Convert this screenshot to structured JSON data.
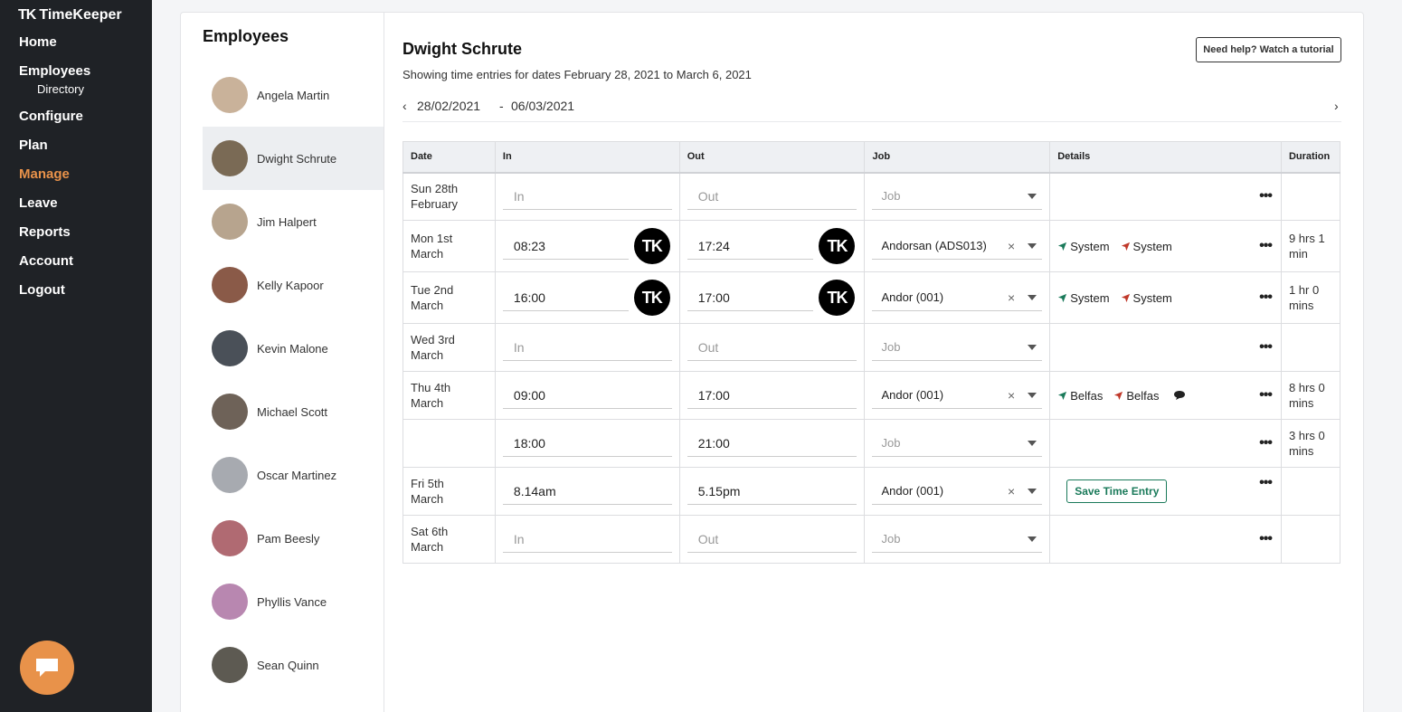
{
  "app": {
    "logo_mark": "TK",
    "logo_text": "TimeKeeper"
  },
  "nav": {
    "home": "Home",
    "employees": "Employees",
    "directory": "Directory",
    "configure": "Configure",
    "plan": "Plan",
    "manage": "Manage",
    "leave": "Leave",
    "reports": "Reports",
    "account": "Account",
    "logout": "Logout",
    "active": "Manage"
  },
  "colors": {
    "accent": "#e8924a",
    "sidebar": "#1f2226",
    "save_green": "#1a7a5a",
    "loc_in": "#1a7a5a",
    "loc_out": "#c0392b"
  },
  "employees": {
    "title": "Employees",
    "list": [
      {
        "name": "Angela Martin",
        "avatar_color": "#c9b29a"
      },
      {
        "name": "Dwight Schrute",
        "avatar_color": "#7a6a55"
      },
      {
        "name": "Jim Halpert",
        "avatar_color": "#b7a48e"
      },
      {
        "name": "Kelly Kapoor",
        "avatar_color": "#8a5a48"
      },
      {
        "name": "Kevin Malone",
        "avatar_color": "#4a5058"
      },
      {
        "name": "Michael Scott",
        "avatar_color": "#6e6258"
      },
      {
        "name": "Oscar Martinez",
        "avatar_color": "#a7aab0"
      },
      {
        "name": "Pam Beesly",
        "avatar_color": "#b06a72"
      },
      {
        "name": "Phyllis Vance",
        "avatar_color": "#b887b0"
      },
      {
        "name": "Sean Quinn",
        "avatar_color": "#5d5a52"
      }
    ],
    "selected": "Dwight Schrute"
  },
  "main": {
    "heading": "Dwight Schrute",
    "subtitle": "Showing time entries for dates February 28, 2021 to March 6, 2021",
    "help_button": "Need help? Watch a tutorial",
    "range_from": "28/02/2021",
    "range_sep": "-",
    "range_to": "06/03/2021"
  },
  "table": {
    "headers": {
      "date": "Date",
      "in": "In",
      "out": "Out",
      "job": "Job",
      "details": "Details",
      "duration": "Duration"
    },
    "placeholders": {
      "in": "In",
      "out": "Out",
      "job": "Job"
    },
    "rows": [
      {
        "date_line1": "Sun 28th",
        "date_line2": "February",
        "in": "In",
        "out": "Out",
        "job": "Job",
        "duration_line1": "",
        "duration_line2": ""
      },
      {
        "date_line1": "Mon 1st",
        "date_line2": "March",
        "in": "08:23",
        "out": "17:24",
        "job": "Andorsan (ADS013)",
        "loc_in": "System",
        "loc_out": "System",
        "duration_line1": "9 hrs 1",
        "duration_line2": "min",
        "tk_label": "TK"
      },
      {
        "date_line1": "Tue 2nd",
        "date_line2": "March",
        "in": "16:00",
        "out": "17:00",
        "job": "Andor (001)",
        "loc_in": "System",
        "loc_out": "System",
        "duration_line1": "1 hr 0",
        "duration_line2": "mins",
        "tk_label": "TK"
      },
      {
        "date_line1": "Wed 3rd",
        "date_line2": "March",
        "in": "In",
        "out": "Out",
        "job": "Job",
        "duration_line1": "",
        "duration_line2": ""
      },
      {
        "date_line1": "Thu 4th",
        "date_line2": "March",
        "in": "09:00",
        "out": "17:00",
        "job": "Andor (001)",
        "loc_in": "Belfas",
        "loc_out": "Belfas",
        "duration_line1": "8 hrs 0",
        "duration_line2": "mins"
      },
      {
        "date_line1": "",
        "date_line2": "",
        "in": "18:00",
        "out": "21:00",
        "job": "Job",
        "duration_line1": "3 hrs 0",
        "duration_line2": "mins"
      },
      {
        "date_line1": "Fri 5th",
        "date_line2": "March",
        "in": "8.14am",
        "out": "5.15pm",
        "job": "Andor (001)",
        "save_label": "Save Time Entry",
        "duration_line1": "",
        "duration_line2": ""
      },
      {
        "date_line1": "Sat 6th",
        "date_line2": "March",
        "in": "In",
        "out": "Out",
        "job": "Job",
        "duration_line1": "",
        "duration_line2": ""
      }
    ]
  }
}
